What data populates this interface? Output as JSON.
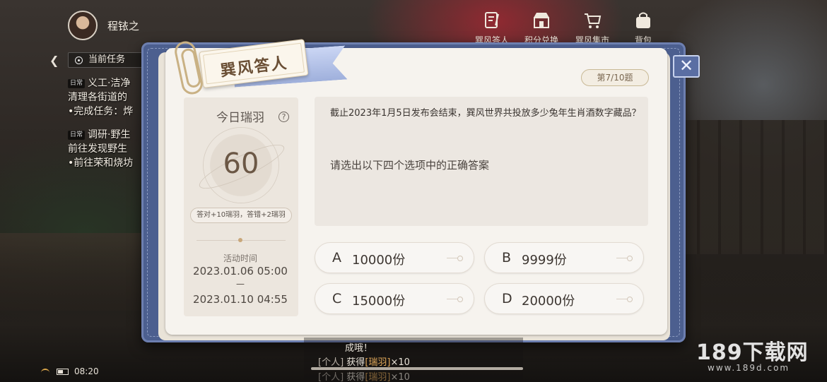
{
  "player": {
    "name": "程铱之"
  },
  "task_panel": {
    "header": "当前任务",
    "tasks": [
      {
        "tag": "日常",
        "title": "义工·洁净",
        "lines": [
          "清理各街道的",
          "•完成任务：烨"
        ]
      },
      {
        "tag": "日常",
        "title": "调研·野生",
        "lines": [
          "前往发现野生",
          "•前往荣和烧坊"
        ]
      }
    ]
  },
  "top_nav": [
    {
      "label": "巽风答人",
      "icon": "notebook-icon"
    },
    {
      "label": "积分兑换",
      "icon": "shop-icon"
    },
    {
      "label": "巽风集市",
      "icon": "cart-icon"
    },
    {
      "label": "背包",
      "icon": "bag-icon"
    }
  ],
  "quiz": {
    "title": "巽风答人",
    "question_number": "第7/10题",
    "stats": {
      "label": "今日瑞羽",
      "help": "?",
      "score": "60",
      "rule": "答对+10瑞羽，答错+2瑞羽",
      "time_label": "活动时间",
      "start": "2023.01.06 05:00",
      "separator": "—",
      "end": "2023.01.10 04:55"
    },
    "question": "截止2023年1月5日发布会结束，巽风世界共投放多少兔年生肖酒数字藏品？",
    "hint": "请选出以下四个选项中的正确答案",
    "options": [
      {
        "letter": "A",
        "text": "10000份"
      },
      {
        "letter": "B",
        "text": "9999份"
      },
      {
        "letter": "C",
        "text": "15000份"
      },
      {
        "letter": "D",
        "text": "20000份"
      }
    ]
  },
  "chat": {
    "line1": "成哦！",
    "line2_channel": "[个人]",
    "line2_text": "获得",
    "line2_item": "[瑞羽]",
    "line2_qty": "×10",
    "line3_channel": "[个人]",
    "line3_text": "获得",
    "line3_item": "[瑞羽]",
    "line3_qty": "×10"
  },
  "status_bar": {
    "time": "08:20"
  },
  "watermark": {
    "main": "189下载网",
    "sub": "www.189d.com"
  },
  "colors": {
    "book_cover": "#4c5f8f",
    "page": "#f6f3ee",
    "accent_gold": "#c9a77a"
  }
}
